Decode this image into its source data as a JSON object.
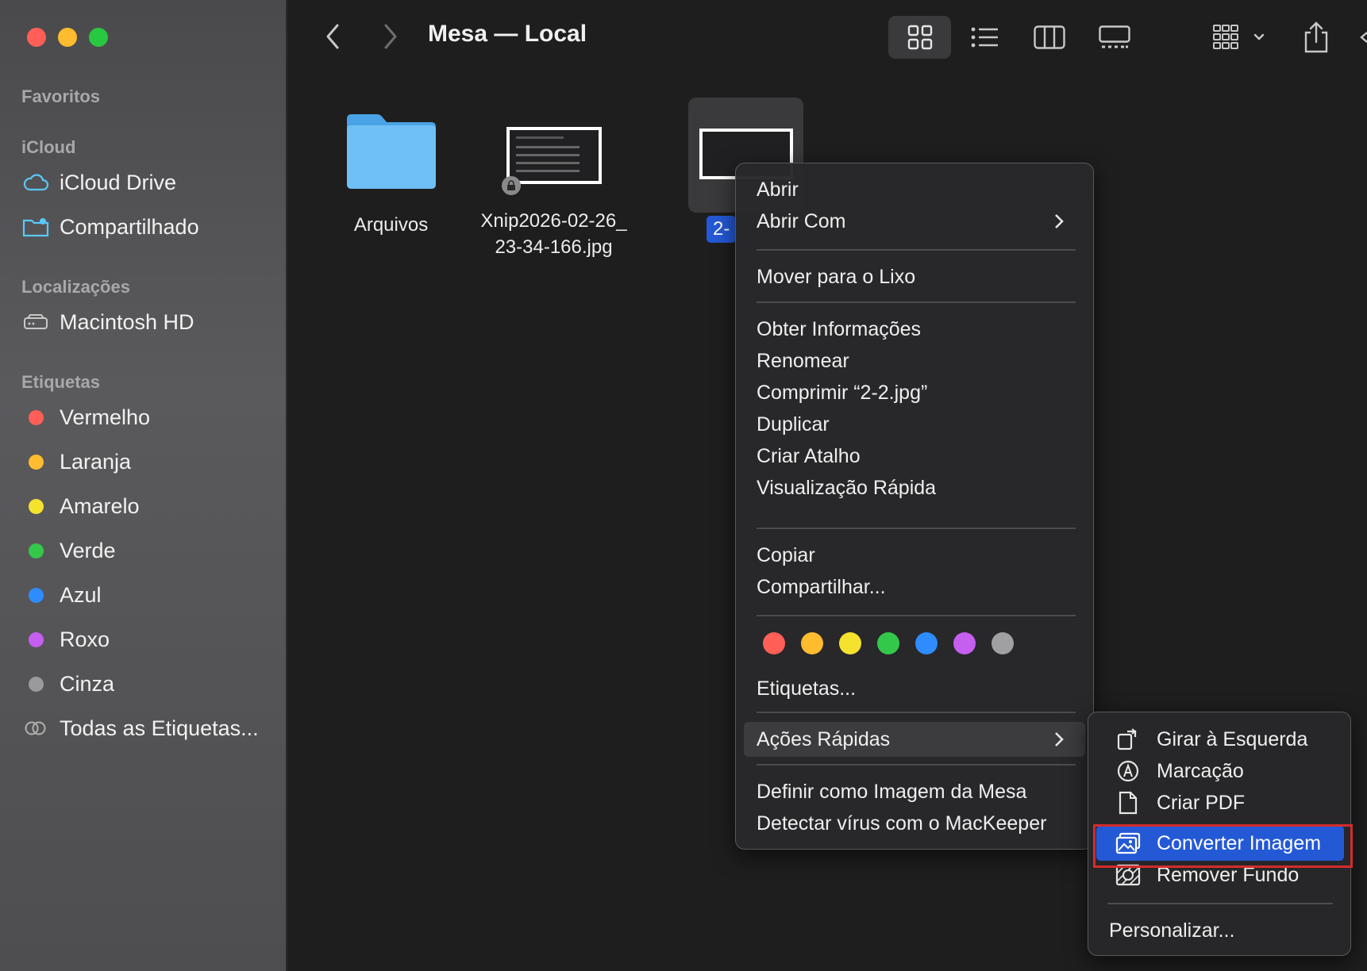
{
  "window": {
    "title": "Mesa — Local"
  },
  "sidebar": {
    "sections": {
      "favorites": "Favoritos",
      "icloud": "iCloud",
      "locations": "Localizações",
      "tags": "Etiquetas"
    },
    "icloud_items": [
      {
        "label": "iCloud Drive",
        "icon": "cloud-icon"
      },
      {
        "label": "Compartilhado",
        "icon": "shared-folder-icon"
      }
    ],
    "location_items": [
      {
        "label": "Macintosh HD",
        "icon": "hard-drive-icon"
      }
    ],
    "tag_items": [
      {
        "label": "Vermelho",
        "color": "#ff5f57"
      },
      {
        "label": "Laranja",
        "color": "#febc2e"
      },
      {
        "label": "Amarelo",
        "color": "#f5e22f"
      },
      {
        "label": "Verde",
        "color": "#34c84a"
      },
      {
        "label": "Azul",
        "color": "#2f8cff"
      },
      {
        "label": "Roxo",
        "color": "#c65ef0"
      },
      {
        "label": "Cinza",
        "color": "#9a9a9c"
      },
      {
        "label": "Todas as Etiquetas...",
        "color": "all-tags-icon"
      }
    ]
  },
  "files": [
    {
      "name": "Arquivos",
      "type": "folder"
    },
    {
      "name_line1": "Xnip2026-02-26_",
      "name_line2": "23-34-166.jpg",
      "type": "image"
    },
    {
      "name_partial": "2-",
      "type": "image",
      "selected": true
    }
  ],
  "context_menu": {
    "items": {
      "open": "Abrir",
      "open_with": "Abrir Com",
      "trash": "Mover para o Lixo",
      "get_info": "Obter Informações",
      "rename": "Renomear",
      "compress": "Comprimir “2-2.jpg”",
      "duplicate": "Duplicar",
      "alias": "Criar Atalho",
      "quick_look": "Visualização Rápida",
      "copy": "Copiar",
      "share": "Compartilhar...",
      "tags": "Etiquetas...",
      "quick_actions": "Ações Rápidas",
      "desktop_picture": "Definir como Imagem da Mesa",
      "scan_virus": "Detectar vírus com o MacKeeper"
    },
    "tag_colors": [
      "#ff5f57",
      "#febc2e",
      "#f5e22f",
      "#34c84a",
      "#2f8cff",
      "#c65ef0",
      "#a0a0a2"
    ]
  },
  "quick_actions_submenu": {
    "items": {
      "rotate_left": "Girar à Esquerda",
      "markup": "Marcação",
      "create_pdf": "Criar PDF",
      "convert_image": "Converter Imagem",
      "remove_background": "Remover Fundo",
      "customize": "Personalizar..."
    },
    "selected": "convert_image"
  }
}
